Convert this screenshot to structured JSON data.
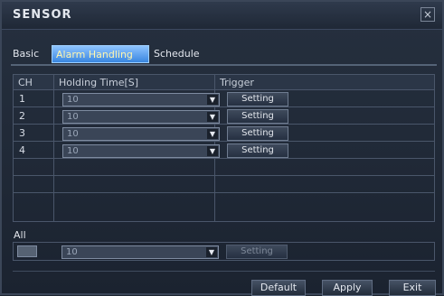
{
  "window": {
    "title": "SENSOR",
    "close_icon": "×"
  },
  "tabs": [
    {
      "label": "Basic"
    },
    {
      "label": "Alarm Handling"
    },
    {
      "label": "Schedule"
    }
  ],
  "table": {
    "headers": {
      "ch": "CH",
      "holding_time": "Holding Time[S]",
      "trigger": "Trigger"
    },
    "rows": [
      {
        "ch": "1",
        "holding_time": "10",
        "trigger": "Setting"
      },
      {
        "ch": "2",
        "holding_time": "10",
        "trigger": "Setting"
      },
      {
        "ch": "3",
        "holding_time": "10",
        "trigger": "Setting"
      },
      {
        "ch": "4",
        "holding_time": "10",
        "trigger": "Setting"
      }
    ]
  },
  "all_section": {
    "label": "All",
    "holding_time": "10",
    "trigger": "Setting"
  },
  "buttons": {
    "default": "Default",
    "apply": "Apply",
    "exit": "Exit"
  },
  "colors": {
    "active_tab": "#3a86e0",
    "background": "#1e2632"
  }
}
